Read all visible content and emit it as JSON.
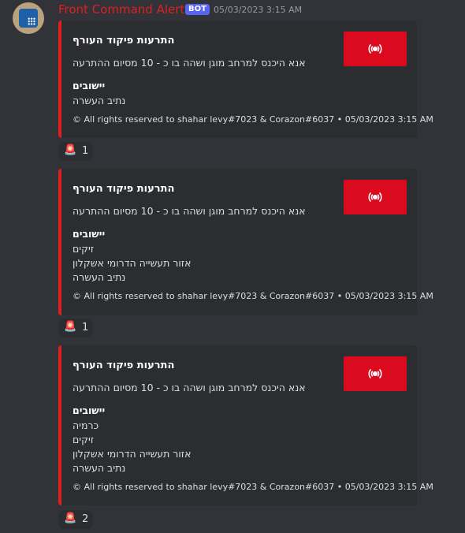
{
  "message": {
    "username": "Front Command Alerts",
    "bot_badge": "BOT",
    "timestamp": "05/03/2023 3:15 AM"
  },
  "embeds": [
    {
      "title": "התרעות פיקוד העורף",
      "description": "אנא היכנס למרחב מוגן ושהה בו כ - 10 מסיום ההתרעה",
      "field_name": "יישובים",
      "field_values": [
        "נתיב העשרה"
      ],
      "footer": "© All rights reserved to shahar levy#7023 & Corazon#6037 • 05/03/2023 3:15 AM",
      "thumbnail_icon": "siren-icon",
      "reaction_emoji": "🚨",
      "reaction_count": "1"
    },
    {
      "title": "התרעות פיקוד העורף",
      "description": "אנא היכנס למרחב מוגן ושהה בו כ - 10 מסיום ההתרעה",
      "field_name": "יישובים",
      "field_values": [
        "זיקים",
        "אזור תעשייה הדרומי אשקלון",
        "נתיב העשרה"
      ],
      "footer": "© All rights reserved to shahar levy#7023 & Corazon#6037 • 05/03/2023 3:15 AM",
      "thumbnail_icon": "siren-icon",
      "reaction_emoji": "🚨",
      "reaction_count": "1"
    },
    {
      "title": "התרעות פיקוד העורף",
      "description": "אנא היכנס למרחב מוגן ושהה בו כ - 10 מסיום ההתרעה",
      "field_name": "יישובים",
      "field_values": [
        "כרמיה",
        "זיקים",
        "אזור תעשייה הדרומי אשקלון",
        "נתיב העשרה"
      ],
      "footer": "© All rights reserved to shahar levy#7023 & Corazon#6037 • 05/03/2023 3:15 AM",
      "thumbnail_icon": "siren-icon",
      "reaction_emoji": "🚨",
      "reaction_count": "2"
    }
  ],
  "colors": {
    "background": "#313338",
    "embed_background": "#2b2d31",
    "accent_red": "#e02020",
    "thumbnail_red": "#dc0a1e",
    "bot_badge": "#5865f2"
  }
}
